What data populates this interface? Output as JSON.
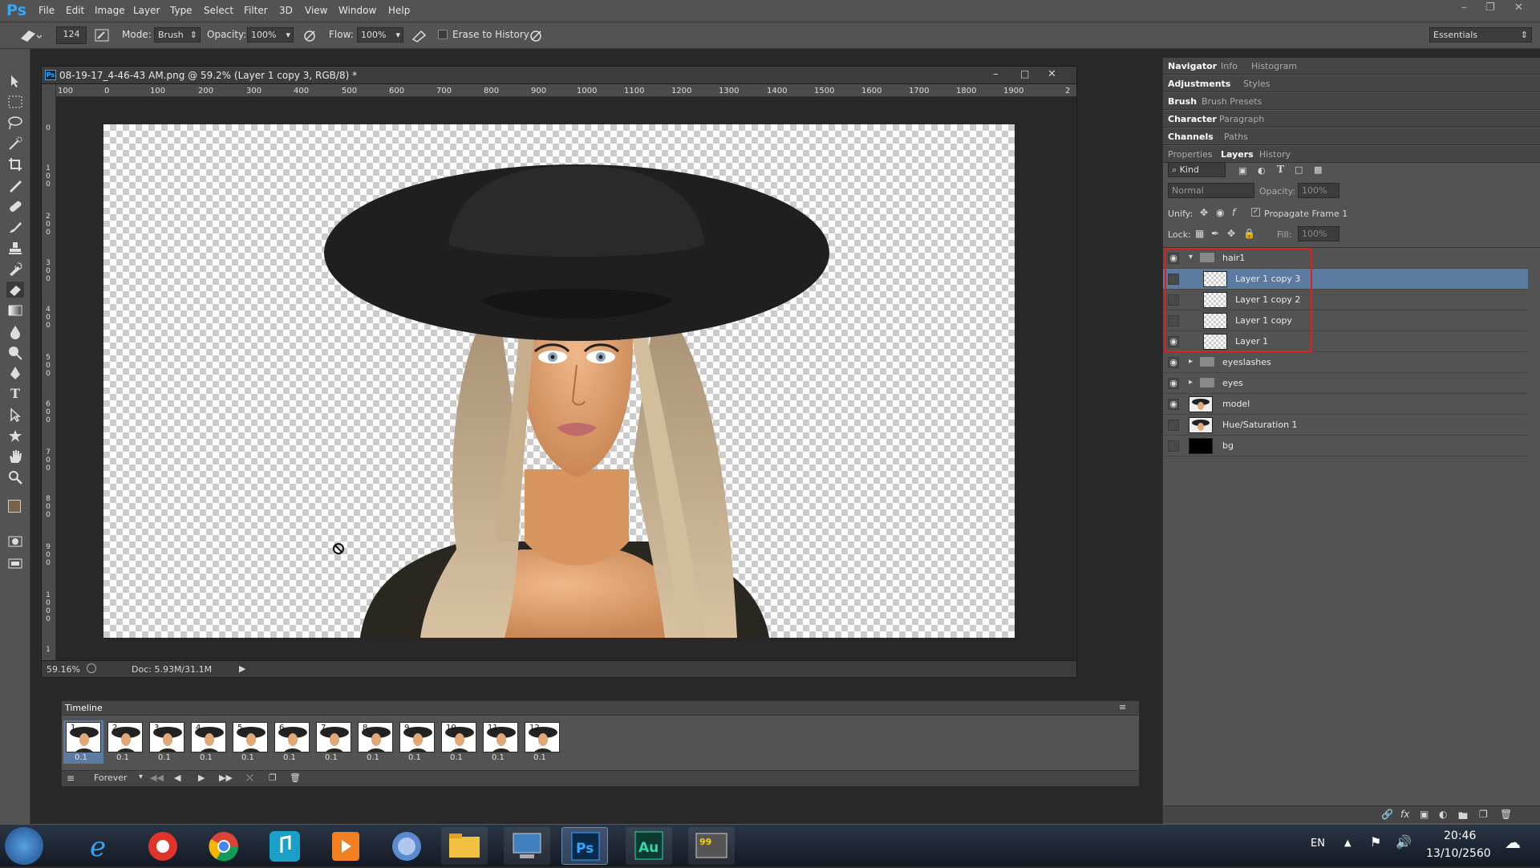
{
  "app": {
    "logo": "Ps"
  },
  "menu": [
    "File",
    "Edit",
    "Image",
    "Layer",
    "Type",
    "Select",
    "Filter",
    "3D",
    "View",
    "Window",
    "Help"
  ],
  "options": {
    "brush_size": "124",
    "mode_label": "Mode:",
    "mode_value": "Brush",
    "opacity_label": "Opacity:",
    "opacity_value": "100%",
    "flow_label": "Flow:",
    "flow_value": "100%",
    "erase_history": "Erase to History",
    "workspace": "Essentials"
  },
  "document": {
    "title": "08-19-17_4-46-43 AM.png @ 59.2% (Layer 1 copy 3, RGB/8) *",
    "zoom": "59.16%",
    "doc_size": "Doc: 5.93M/31.1M",
    "ruler_top": [
      "100",
      "0",
      "100",
      "200",
      "300",
      "400",
      "500",
      "600",
      "700",
      "800",
      "900",
      "1000",
      "1100",
      "1200",
      "1300",
      "1400",
      "1500",
      "1600",
      "1700",
      "1800",
      "1900",
      "2"
    ],
    "ruler_left": [
      "0",
      "1 0 0",
      "2 0 0",
      "3 0 0",
      "4 0 0",
      "5 0 0",
      "6 0 0",
      "7 0 0",
      "8 0 0",
      "9 0 0",
      "1 0 0 0",
      "1"
    ]
  },
  "timeline": {
    "title": "Timeline",
    "frames": [
      {
        "num": "1",
        "delay": "0.1"
      },
      {
        "num": "2",
        "delay": "0.1"
      },
      {
        "num": "3",
        "delay": "0.1"
      },
      {
        "num": "4",
        "delay": "0.1"
      },
      {
        "num": "5",
        "delay": "0.1"
      },
      {
        "num": "6",
        "delay": "0.1"
      },
      {
        "num": "7",
        "delay": "0.1"
      },
      {
        "num": "8",
        "delay": "0.1"
      },
      {
        "num": "9",
        "delay": "0.1"
      },
      {
        "num": "10",
        "delay": "0.1"
      },
      {
        "num": "11",
        "delay": "0.1"
      },
      {
        "num": "12",
        "delay": "0.1"
      }
    ],
    "loop": "Forever",
    "selected_frame": 1
  },
  "panels": {
    "row1": [
      "Navigator",
      "Info",
      "Histogram"
    ],
    "row2": [
      "Adjustments",
      "Styles"
    ],
    "row3": [
      "Brush",
      "Brush Presets"
    ],
    "row4": [
      "Character",
      "Paragraph"
    ],
    "row5": [
      "Channels",
      "Paths"
    ],
    "row6": [
      "Properties",
      "Layers",
      "History"
    ],
    "kind": "Kind",
    "blend_mode": "Normal",
    "opacity_label": "Opacity:",
    "opacity_value": "100%",
    "unify_label": "Unify:",
    "propagate": "Propagate Frame 1",
    "lock_label": "Lock:",
    "fill_label": "Fill:",
    "fill_value": "100%"
  },
  "layers": [
    {
      "name": "hair1",
      "type": "group",
      "open": true,
      "visible": true,
      "indent": 0
    },
    {
      "name": "Layer 1 copy 3",
      "type": "layer",
      "visible": false,
      "indent": 1,
      "selected": true
    },
    {
      "name": "Layer 1 copy 2",
      "type": "layer",
      "visible": false,
      "indent": 1
    },
    {
      "name": "Layer 1 copy",
      "type": "layer",
      "visible": false,
      "indent": 1
    },
    {
      "name": "Layer 1",
      "type": "layer",
      "visible": true,
      "indent": 1
    },
    {
      "name": "eyeslashes",
      "type": "group",
      "open": false,
      "visible": true,
      "indent": 0
    },
    {
      "name": "eyes",
      "type": "group",
      "open": false,
      "visible": true,
      "indent": 0
    },
    {
      "name": "model",
      "type": "image",
      "visible": true,
      "indent": 0
    },
    {
      "name": "Hue/Saturation 1",
      "type": "image",
      "visible": false,
      "indent": 0
    },
    {
      "name": "bg",
      "type": "black",
      "visible": false,
      "indent": 0
    }
  ],
  "taskbar": {
    "apps": [
      "start-orb",
      "internet-explorer",
      "app-red",
      "chrome",
      "app-music",
      "app-media",
      "app-globe",
      "file-explorer",
      "remote-desktop",
      "photoshop",
      "audition",
      "app-99"
    ],
    "lang": "EN",
    "time": "20:46",
    "date": "13/10/2560"
  },
  "colors": {
    "accent_ps": "#31a8ff",
    "selection": "#5c7ba0",
    "highlight_box": "#e02020"
  }
}
